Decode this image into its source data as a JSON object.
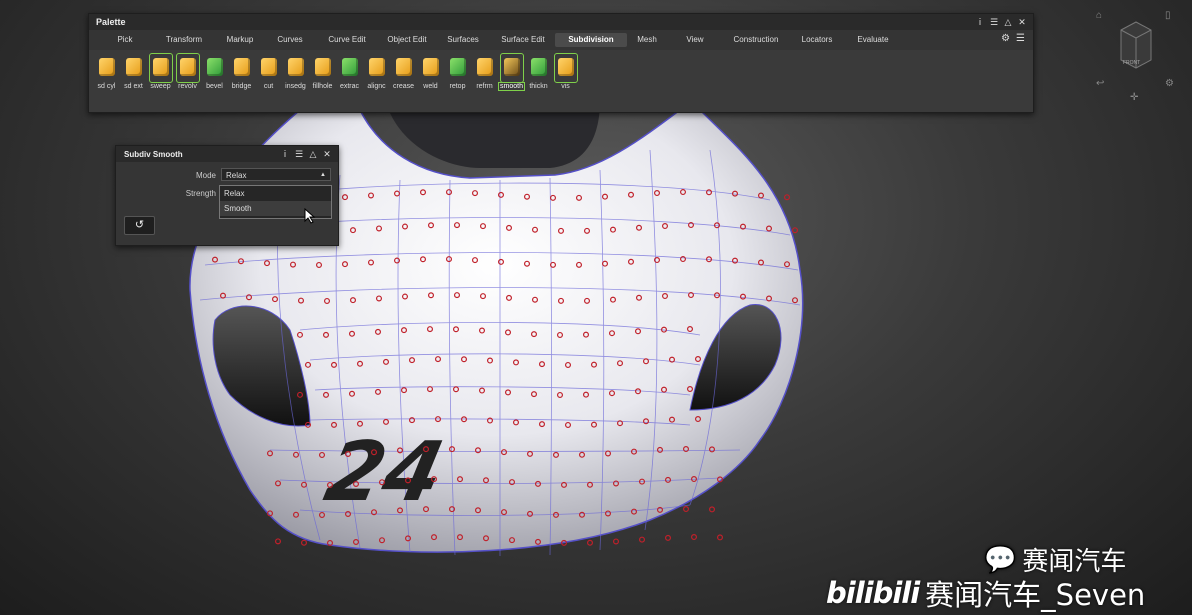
{
  "palette": {
    "title": "Palette",
    "tabs": [
      "Pick",
      "Transform",
      "Markup",
      "Curves",
      "Curve Edit",
      "Object Edit",
      "Surfaces",
      "Surface Edit",
      "Subdivision",
      "Mesh",
      "View",
      "Construction",
      "Locators",
      "Evaluate"
    ],
    "active_tab": "Subdivision",
    "tools": [
      {
        "label": "sd cyl",
        "icon": "cylinder-icon"
      },
      {
        "label": "sd ext",
        "icon": "extrude-icon"
      },
      {
        "label": "sweep",
        "icon": "sweep-icon"
      },
      {
        "label": "revolv",
        "icon": "revolve-icon"
      },
      {
        "label": "bevel",
        "icon": "bevel-icon"
      },
      {
        "label": "bridge",
        "icon": "bridge-icon"
      },
      {
        "label": "cut",
        "icon": "cut-icon"
      },
      {
        "label": "insedg",
        "icon": "insert-edge-icon"
      },
      {
        "label": "fillhole",
        "icon": "fill-hole-icon"
      },
      {
        "label": "extrac",
        "icon": "extract-icon"
      },
      {
        "label": "alignc",
        "icon": "align-icon"
      },
      {
        "label": "crease",
        "icon": "crease-icon"
      },
      {
        "label": "weld",
        "icon": "weld-icon"
      },
      {
        "label": "retop",
        "icon": "retopo-icon"
      },
      {
        "label": "refrm",
        "icon": "reform-icon"
      },
      {
        "label": "smooth",
        "icon": "smooth-icon"
      },
      {
        "label": "thickn",
        "icon": "thicken-icon"
      },
      {
        "label": "vis",
        "icon": "visibility-icon"
      }
    ]
  },
  "dialog": {
    "title": "Subdiv Smooth",
    "mode_label": "Mode",
    "mode_value": "Relax",
    "strength_label": "Strength",
    "dropdown_options": [
      "Relax",
      "Smooth"
    ],
    "hovered_option": "Smooth"
  },
  "viewcube": {
    "face_label": "FRONT"
  },
  "model": {
    "race_number": "24"
  },
  "watermarks": {
    "line1": "赛闻汽车",
    "line2_brand": "bilibili",
    "line2_text": "赛闻汽车_Seven"
  },
  "colors": {
    "accent_green": "#7fd04a",
    "cv_red": "#c0202a",
    "hull_blue": "#5550c8"
  }
}
